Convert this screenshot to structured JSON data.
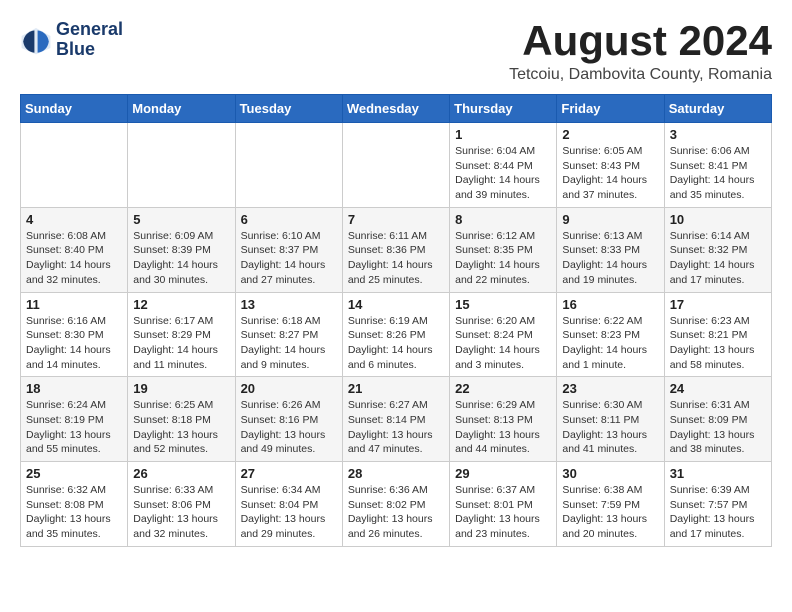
{
  "logo": {
    "line1": "General",
    "line2": "Blue"
  },
  "title": "August 2024",
  "subtitle": "Tetcoiu, Dambovita County, Romania",
  "weekdays": [
    "Sunday",
    "Monday",
    "Tuesday",
    "Wednesday",
    "Thursday",
    "Friday",
    "Saturday"
  ],
  "weeks": [
    [
      {
        "day": "",
        "info": ""
      },
      {
        "day": "",
        "info": ""
      },
      {
        "day": "",
        "info": ""
      },
      {
        "day": "",
        "info": ""
      },
      {
        "day": "1",
        "info": "Sunrise: 6:04 AM\nSunset: 8:44 PM\nDaylight: 14 hours and 39 minutes."
      },
      {
        "day": "2",
        "info": "Sunrise: 6:05 AM\nSunset: 8:43 PM\nDaylight: 14 hours and 37 minutes."
      },
      {
        "day": "3",
        "info": "Sunrise: 6:06 AM\nSunset: 8:41 PM\nDaylight: 14 hours and 35 minutes."
      }
    ],
    [
      {
        "day": "4",
        "info": "Sunrise: 6:08 AM\nSunset: 8:40 PM\nDaylight: 14 hours and 32 minutes."
      },
      {
        "day": "5",
        "info": "Sunrise: 6:09 AM\nSunset: 8:39 PM\nDaylight: 14 hours and 30 minutes."
      },
      {
        "day": "6",
        "info": "Sunrise: 6:10 AM\nSunset: 8:37 PM\nDaylight: 14 hours and 27 minutes."
      },
      {
        "day": "7",
        "info": "Sunrise: 6:11 AM\nSunset: 8:36 PM\nDaylight: 14 hours and 25 minutes."
      },
      {
        "day": "8",
        "info": "Sunrise: 6:12 AM\nSunset: 8:35 PM\nDaylight: 14 hours and 22 minutes."
      },
      {
        "day": "9",
        "info": "Sunrise: 6:13 AM\nSunset: 8:33 PM\nDaylight: 14 hours and 19 minutes."
      },
      {
        "day": "10",
        "info": "Sunrise: 6:14 AM\nSunset: 8:32 PM\nDaylight: 14 hours and 17 minutes."
      }
    ],
    [
      {
        "day": "11",
        "info": "Sunrise: 6:16 AM\nSunset: 8:30 PM\nDaylight: 14 hours and 14 minutes."
      },
      {
        "day": "12",
        "info": "Sunrise: 6:17 AM\nSunset: 8:29 PM\nDaylight: 14 hours and 11 minutes."
      },
      {
        "day": "13",
        "info": "Sunrise: 6:18 AM\nSunset: 8:27 PM\nDaylight: 14 hours and 9 minutes."
      },
      {
        "day": "14",
        "info": "Sunrise: 6:19 AM\nSunset: 8:26 PM\nDaylight: 14 hours and 6 minutes."
      },
      {
        "day": "15",
        "info": "Sunrise: 6:20 AM\nSunset: 8:24 PM\nDaylight: 14 hours and 3 minutes."
      },
      {
        "day": "16",
        "info": "Sunrise: 6:22 AM\nSunset: 8:23 PM\nDaylight: 14 hours and 1 minute."
      },
      {
        "day": "17",
        "info": "Sunrise: 6:23 AM\nSunset: 8:21 PM\nDaylight: 13 hours and 58 minutes."
      }
    ],
    [
      {
        "day": "18",
        "info": "Sunrise: 6:24 AM\nSunset: 8:19 PM\nDaylight: 13 hours and 55 minutes."
      },
      {
        "day": "19",
        "info": "Sunrise: 6:25 AM\nSunset: 8:18 PM\nDaylight: 13 hours and 52 minutes."
      },
      {
        "day": "20",
        "info": "Sunrise: 6:26 AM\nSunset: 8:16 PM\nDaylight: 13 hours and 49 minutes."
      },
      {
        "day": "21",
        "info": "Sunrise: 6:27 AM\nSunset: 8:14 PM\nDaylight: 13 hours and 47 minutes."
      },
      {
        "day": "22",
        "info": "Sunrise: 6:29 AM\nSunset: 8:13 PM\nDaylight: 13 hours and 44 minutes."
      },
      {
        "day": "23",
        "info": "Sunrise: 6:30 AM\nSunset: 8:11 PM\nDaylight: 13 hours and 41 minutes."
      },
      {
        "day": "24",
        "info": "Sunrise: 6:31 AM\nSunset: 8:09 PM\nDaylight: 13 hours and 38 minutes."
      }
    ],
    [
      {
        "day": "25",
        "info": "Sunrise: 6:32 AM\nSunset: 8:08 PM\nDaylight: 13 hours and 35 minutes."
      },
      {
        "day": "26",
        "info": "Sunrise: 6:33 AM\nSunset: 8:06 PM\nDaylight: 13 hours and 32 minutes."
      },
      {
        "day": "27",
        "info": "Sunrise: 6:34 AM\nSunset: 8:04 PM\nDaylight: 13 hours and 29 minutes."
      },
      {
        "day": "28",
        "info": "Sunrise: 6:36 AM\nSunset: 8:02 PM\nDaylight: 13 hours and 26 minutes."
      },
      {
        "day": "29",
        "info": "Sunrise: 6:37 AM\nSunset: 8:01 PM\nDaylight: 13 hours and 23 minutes."
      },
      {
        "day": "30",
        "info": "Sunrise: 6:38 AM\nSunset: 7:59 PM\nDaylight: 13 hours and 20 minutes."
      },
      {
        "day": "31",
        "info": "Sunrise: 6:39 AM\nSunset: 7:57 PM\nDaylight: 13 hours and 17 minutes."
      }
    ]
  ]
}
